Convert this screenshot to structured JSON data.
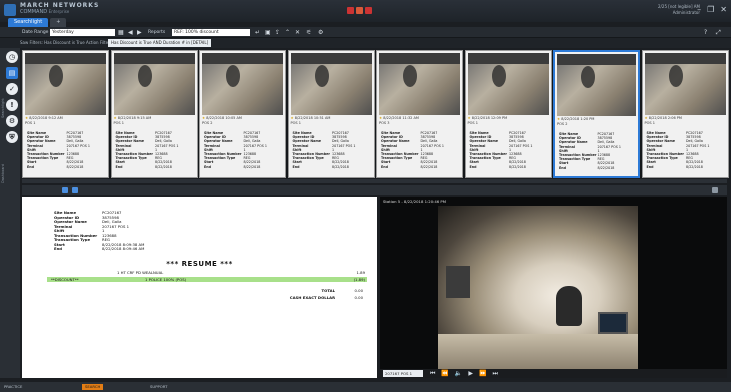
{
  "app": {
    "brand_line1": "MARCH NETWORKS",
    "brand_line2": "COMMAND",
    "brand_sub": "Enterprise",
    "clock_line1": "2/25 [not legible] AM",
    "clock_line2": "Administrator"
  },
  "tabs": [
    {
      "label": "Searchlight"
    },
    {
      "label": "+"
    }
  ],
  "toolbar": {
    "date_range_label": "Date Range",
    "date_range_value": "Yesterday",
    "reports_label": "Reports",
    "report_value": "REF: 100% discount"
  },
  "filter": {
    "text": "Saw Filters: Has Discount is True   Action Filters",
    "chip": "Has Discount is True AND Duration # in [DETAIL]"
  },
  "sidebar": {
    "vtab_top": "Searchlight",
    "vtab_bottom": "Dashboard",
    "buttons": [
      {
        "icon": "clock-icon",
        "glyph": "◷"
      },
      {
        "icon": "receipt-icon",
        "glyph": "▤"
      },
      {
        "icon": "checkmark-icon",
        "glyph": "✓"
      },
      {
        "icon": "alert-icon",
        "glyph": "!"
      },
      {
        "icon": "settings-icon",
        "glyph": "⚙"
      },
      {
        "icon": "shield-icon",
        "glyph": "⛨"
      }
    ]
  },
  "cards": [
    {
      "time": "8/22/2018 9:12 AM",
      "pos": "POS 1",
      "selected": false
    },
    {
      "time": "8/22/2018 9:15 AM",
      "pos": "POS 1",
      "selected": false
    },
    {
      "time": "8/22/2018 10:05 AM",
      "pos": "POS 2",
      "selected": false
    },
    {
      "time": "8/22/2018 10:51 AM",
      "pos": "POS 1",
      "selected": false
    },
    {
      "time": "8/22/2018 11:32 AM",
      "pos": "POS 3",
      "selected": false
    },
    {
      "time": "8/22/2018 12:09 PM",
      "pos": "POS 1",
      "selected": false
    },
    {
      "time": "8/22/2018 1:20 PM",
      "pos": "POS 2",
      "selected": true
    },
    {
      "time": "8/22/2018 2:06 PM",
      "pos": "POS 1",
      "selected": false
    }
  ],
  "card_fields": [
    "Site Name",
    "Operator ID",
    "Operator Name",
    "Terminal",
    "Shift",
    "Transaction Number",
    "Transaction Type",
    "Start",
    "End"
  ],
  "card_values": [
    "PC207167",
    "3875598",
    "Deli, Galla",
    "207167 POS 1",
    "1",
    "123688",
    "REG",
    "8/22/2018",
    "8/22/2018"
  ],
  "receipt": {
    "info_labels": [
      "Site Name",
      "Operator ID",
      "Operator Name",
      "Terminal",
      "Shift",
      "Transaction Number",
      "Transaction Type",
      "Start",
      "End"
    ],
    "info_values": [
      "PC207167",
      "3875598",
      "Deli, Galla",
      "207167 POS 1",
      "1",
      "123688",
      "REG",
      "8/22/2018 8:09:38 AM",
      "8/22/2018 8:09:46 AM"
    ],
    "title": "*** RESUME ***",
    "line1_left": "1 HT CRF PD WEALNUAL",
    "line1_right": "1.89",
    "line2_left": "**DISCOUNT**",
    "line2_mid": "1 POLICE 100% (POS)",
    "line2_right": "(1.89)",
    "total_label": "TOTAL",
    "total_value": "0.00",
    "cash_label": "CASH EXACT DOLLAR",
    "cash_value": "0.00"
  },
  "video": {
    "title": "Station 5 - 8/22/2018 1:20:46 PM",
    "camera_field": "207167 POS 1"
  },
  "status": {
    "left": "PRACTICE",
    "chip": "SEARCH",
    "right": "SUPPORT"
  }
}
